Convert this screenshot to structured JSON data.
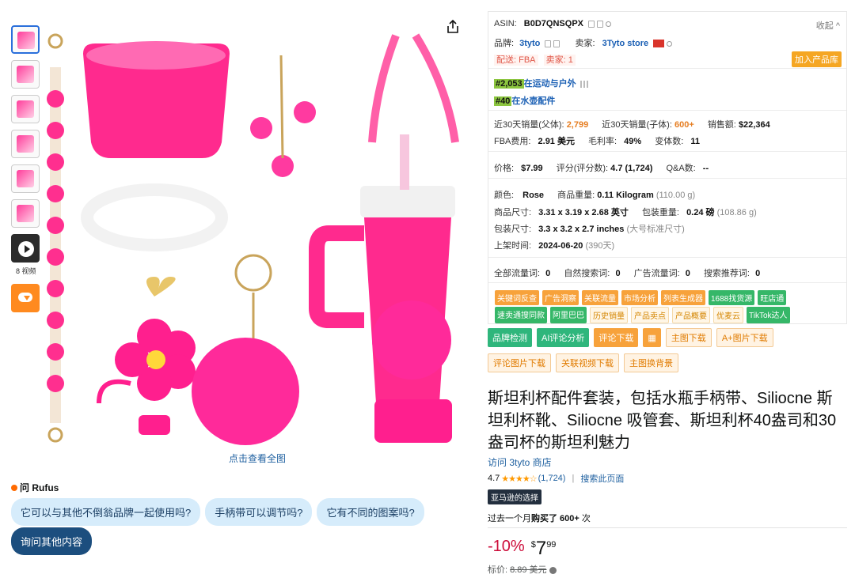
{
  "gallery": {
    "video_count_label": "8 视频",
    "view_all": "点击查看全图"
  },
  "rufus": {
    "title": "问 Rufus",
    "chips": [
      "它可以与其他不倒翁品牌一起使用吗?",
      "手柄带可以调节吗?",
      "它有不同的图案吗?"
    ],
    "ask_more": "询问其他内容"
  },
  "panel": {
    "asin_label": "ASIN:",
    "asin": "B0D7QNSQPX",
    "collapse": "收起",
    "brand_label": "品牌:",
    "brand": "3tyto",
    "seller_label": "卖家:",
    "seller": "3Tyto store",
    "ship_tag": "配送: FBA",
    "seller_count_tag": "卖家: 1",
    "add_product": "加入产品库",
    "rank1_num": "#2,053",
    "rank1_cat": "在运动与户外",
    "rank2_num": "#40",
    "rank2_cat": "在水壶配件",
    "sales30_parent_label": "近30天销量(父体):",
    "sales30_parent": "2,799",
    "sales30_child_label": "近30天销量(子体):",
    "sales30_child": "600+",
    "revenue_label": "销售额:",
    "revenue": "$22,364",
    "fba_label": "FBA费用:",
    "fba": "2.91 美元",
    "margin_label": "毛利率:",
    "margin": "49%",
    "variants_label": "变体数:",
    "variants": "11",
    "price_label": "价格:",
    "price": "$7.99",
    "rating_label": "评分(评分数):",
    "rating": "4.7 (1,724)",
    "qa_label": "Q&A数:",
    "qa": "--",
    "color_label": "颜色:",
    "color": "Rose",
    "weight_label": "商品重量:",
    "weight": "0.11 Kilogram",
    "weight_g": "(110.00 g)",
    "dims_label": "商品尺寸:",
    "dims": "3.31 x 3.19 x 2.68 英寸",
    "pkg_weight_label": "包装重量:",
    "pkg_weight": "0.24 磅",
    "pkg_weight_g": "(108.86 g)",
    "pkg_dims_label": "包装尺寸:",
    "pkg_dims": "3.3 x 3.2 x 2.7 inches",
    "pkg_size_class": "(大号标准尺寸)",
    "listed_label": "上架时间:",
    "listed": "2024-06-20",
    "listed_days": "(390天)",
    "all_traffic_label": "全部流量词:",
    "all_traffic": "0",
    "organic_label": "自然搜索词:",
    "organic": "0",
    "ad_label": "广告流量词:",
    "ad": "0",
    "rec_label": "搜索推荐词:",
    "rec": "0",
    "tags_row1": [
      {
        "t": "关键词反查",
        "k": "o"
      },
      {
        "t": "广告洞察",
        "k": "o"
      },
      {
        "t": "关联流量",
        "k": "o"
      },
      {
        "t": "市场分析",
        "k": "o"
      },
      {
        "t": "列表生成器",
        "k": "o"
      },
      {
        "t": "1688找货源",
        "k": "g"
      },
      {
        "t": "旺店通",
        "k": "g"
      }
    ],
    "tags_row2": [
      {
        "t": "速卖通搜同款",
        "k": "g"
      },
      {
        "t": "阿里巴巴",
        "k": "g"
      },
      {
        "t": "历史销量",
        "k": "l"
      },
      {
        "t": "产品卖点",
        "k": "l"
      },
      {
        "t": "产品概要",
        "k": "l"
      },
      {
        "t": "优麦云",
        "k": "l"
      },
      {
        "t": "TikTok达人",
        "k": "g"
      }
    ]
  },
  "actions": {
    "brand_check": "品牌检测",
    "ai_review": "AI评论分析",
    "review_dl": "评论下载",
    "main_img_dl": "主图下载",
    "aplus_dl": "A+图片下载",
    "review_img_dl": "评论图片下载",
    "video_dl": "关联视频下载",
    "main_bg": "主图换背景"
  },
  "product": {
    "title": "斯坦利杯配件套装，包括水瓶手柄带、Siliocne 斯坦利杯靴、Siliocne 吸管套、斯坦利杯40盎司和30盎司杯的斯坦利魅力",
    "visit_store": "访问 3tyto 商店",
    "rating": "4.7",
    "stars": "★★★★☆",
    "rating_count": "(1,724)",
    "search_page": "搜索此页面",
    "badge": "亚马逊的选择",
    "bought_prefix": "过去一个月",
    "bought_bold": "购买了 600+",
    "bought_suffix": " 次",
    "discount": "-10%",
    "currency": "$",
    "price_whole": "7",
    "price_frac": "99",
    "list_label": "标价:",
    "list_price": "8.89 美元"
  },
  "colors": {
    "accent": "#ff1f8e",
    "link": "#2162a1",
    "orange": "#f7a23b",
    "green": "#2fb67c"
  }
}
